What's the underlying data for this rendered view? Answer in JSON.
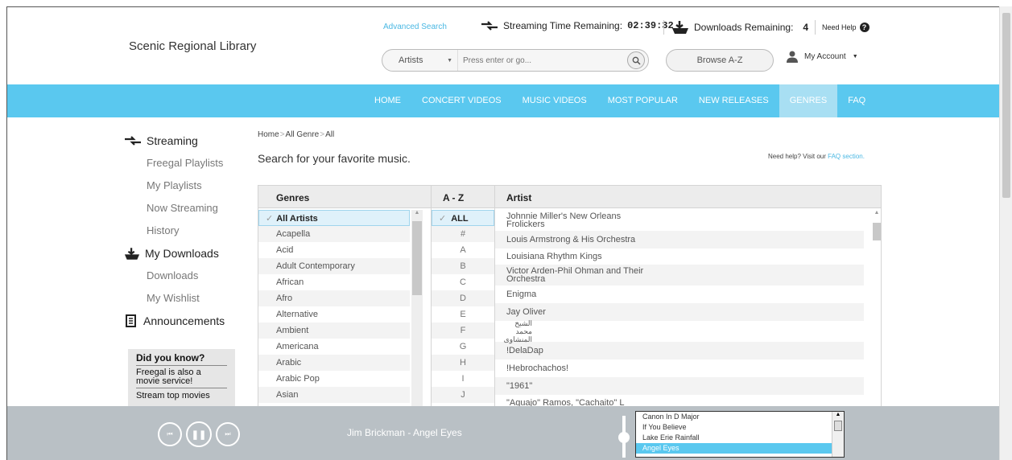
{
  "header": {
    "library_name": "Scenic Regional Library",
    "advanced_search": "Advanced Search",
    "streaming_label": "Streaming Time Remaining:",
    "streaming_time": "02:39:32",
    "downloads_label": "Downloads Remaining:",
    "downloads_count": "4",
    "need_help": "Need Help",
    "search_type": "Artists",
    "search_placeholder": "Press enter or go...",
    "browse": "Browse A-Z",
    "account": "My Account"
  },
  "nav": [
    {
      "label": "HOME",
      "active": false
    },
    {
      "label": "CONCERT VIDEOS",
      "active": false
    },
    {
      "label": "MUSIC VIDEOS",
      "active": false
    },
    {
      "label": "MOST POPULAR",
      "active": false
    },
    {
      "label": "NEW RELEASES",
      "active": false
    },
    {
      "label": "GENRES",
      "active": true
    },
    {
      "label": "FAQ",
      "active": false
    }
  ],
  "sidebar": {
    "streaming": "Streaming",
    "streaming_items": [
      "Freegal Playlists",
      "My Playlists",
      "Now Streaming",
      "History"
    ],
    "downloads": "My Downloads",
    "download_items": [
      "Downloads",
      "My Wishlist"
    ],
    "announcements": "Announcements",
    "did_you_know": {
      "title": "Did you know?",
      "text": "Freegal is also a movie service!",
      "link": "Stream top movies"
    }
  },
  "main": {
    "breadcrumb": [
      "Home",
      "All Genre",
      "All"
    ],
    "tagline": "Search for your favorite music.",
    "help_text": "Need help? Visit our",
    "help_link": "FAQ section.",
    "col_genres": "Genres",
    "col_az": "A - Z",
    "col_artist": "Artist",
    "genres": [
      "All Artists",
      "Acapella",
      "Acid",
      "Adult Contemporary",
      "African",
      "Afro",
      "Alternative",
      "Ambient",
      "Americana",
      "Arabic",
      "Arabic Pop",
      "Asian"
    ],
    "az": [
      "ALL",
      "#",
      "A",
      "B",
      "C",
      "D",
      "E",
      "F",
      "G",
      "H",
      "I",
      "J"
    ],
    "artists": [
      "Johnnie Miller's New Orleans Frolickers",
      "Louis Armstrong & His Orchestra",
      "Louisiana Rhythm Kings",
      "Victor Arden-Phil Ohman and Their Orchestra",
      "Enigma",
      "Jay Oliver",
      "الشيخ محمد المنشاوى",
      "!DelaDap",
      "!Hebrochachos!",
      "\"1961\"",
      "\"Aquajo\" Ramos, \"Cachaito\" L"
    ]
  },
  "player": {
    "now_playing": "Jim Brickman - Angel Eyes",
    "playlist": [
      "Canon In D Major",
      "If You Believe",
      "Lake Erie Rainfall",
      "Angel Eyes"
    ],
    "selected_index": 3
  }
}
